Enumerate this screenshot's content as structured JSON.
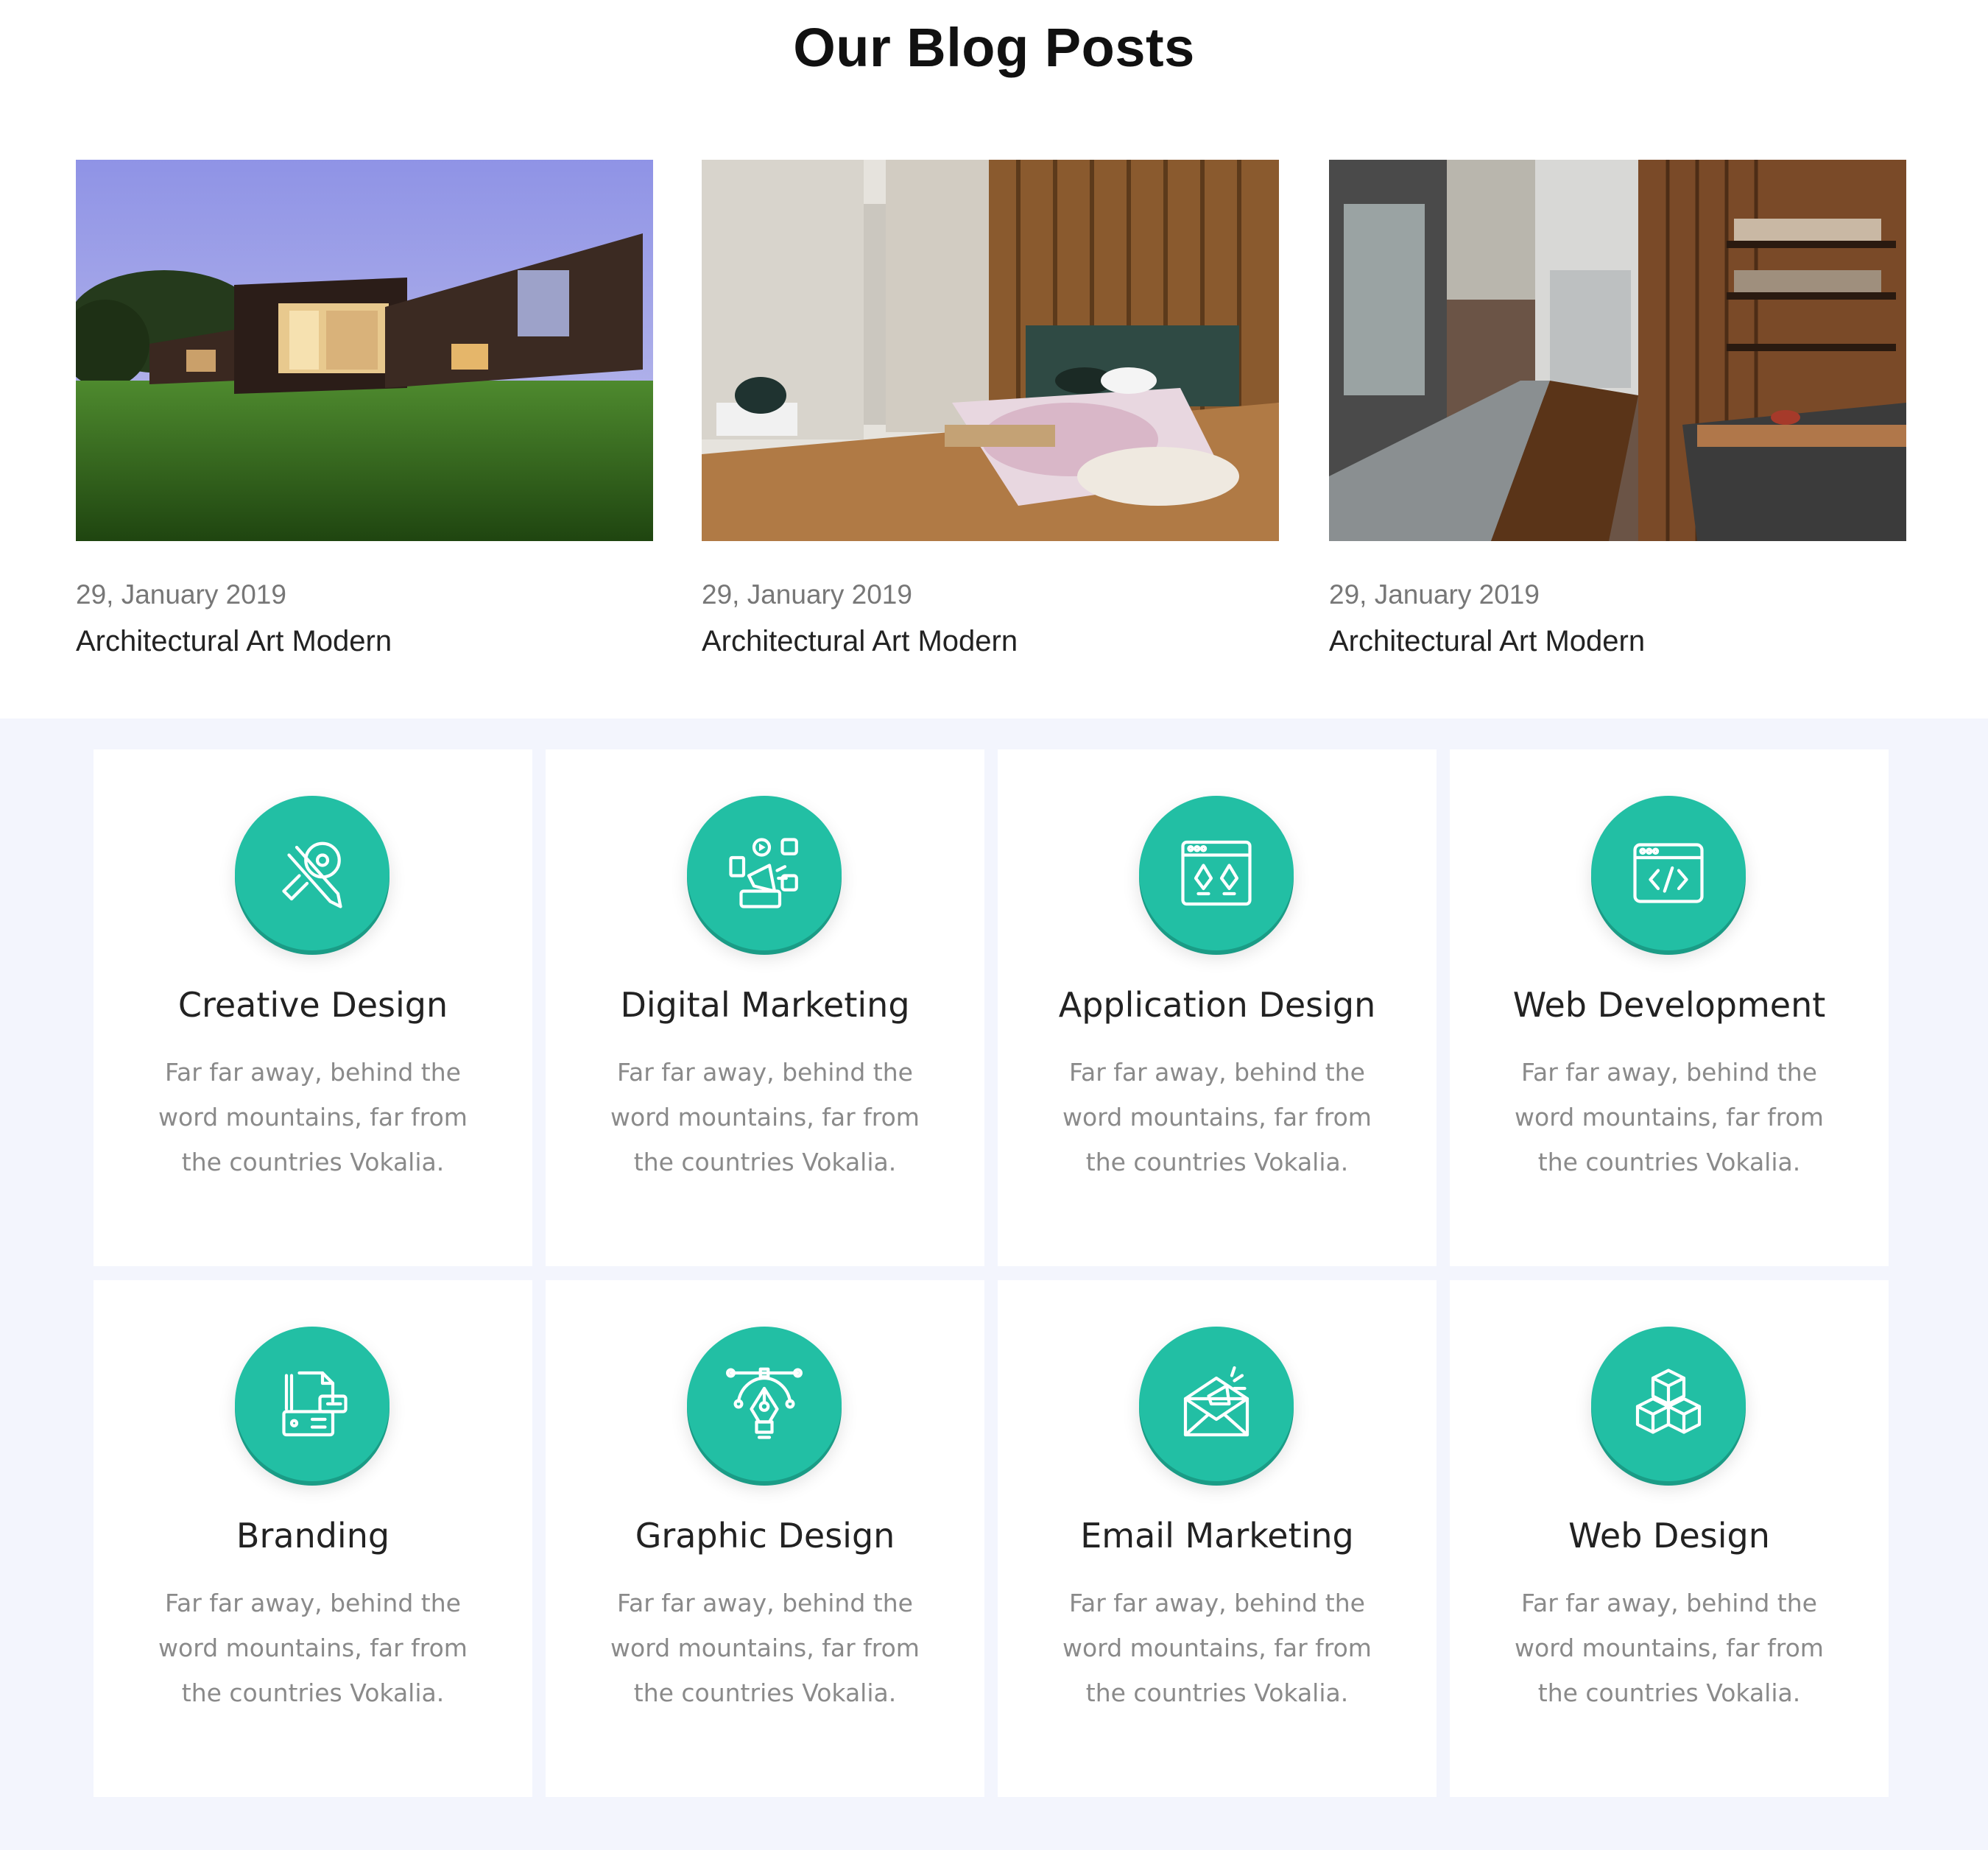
{
  "blog": {
    "title": "Our Blog Posts",
    "posts": [
      {
        "date": "29, January 2019",
        "title": "Architectural Art Modern",
        "image": "modern dark house on green lawn"
      },
      {
        "date": "29, January 2019",
        "title": "Architectural Art Modern",
        "image": "bedroom with wooden wall and floral bedding"
      },
      {
        "date": "29, January 2019",
        "title": "Architectural Art Modern",
        "image": "kitchen with wooden shelves and steel counter"
      }
    ]
  },
  "services": {
    "accent_color": "#22bfa4",
    "items": [
      {
        "title": "Creative Design",
        "icon": "pencil-ruler-icon",
        "desc_lines": [
          "Far far away, behind the",
          "word mountains, far from",
          "the countries Vokalia."
        ]
      },
      {
        "title": "Digital Marketing",
        "icon": "megaphone-social-icon",
        "desc_lines": [
          "Far far away, behind the",
          "word mountains, far from",
          "the countries Vokalia."
        ]
      },
      {
        "title": "Application Design",
        "icon": "browser-pen-tools-icon",
        "desc_lines": [
          "Far far away, behind the",
          "word mountains, far from",
          "the countries Vokalia."
        ]
      },
      {
        "title": "Web Development",
        "icon": "browser-code-icon",
        "desc_lines": [
          "Far far away, behind the",
          "word mountains, far from",
          "the countries Vokalia."
        ]
      },
      {
        "title": "Branding",
        "icon": "stationery-icon",
        "desc_lines": [
          "Far far away, behind the",
          "word mountains, far from",
          "the countries Vokalia."
        ]
      },
      {
        "title": "Graphic Design",
        "icon": "pen-tool-bezier-icon",
        "desc_lines": [
          "Far far away, behind the",
          "word mountains, far from",
          "the countries Vokalia."
        ]
      },
      {
        "title": "Email Marketing",
        "icon": "envelope-megaphone-icon",
        "desc_lines": [
          "Far far away, behind the",
          "word mountains, far from",
          "the countries Vokalia."
        ]
      },
      {
        "title": "Web Design",
        "icon": "cubes-icon",
        "desc_lines": [
          "Far far away, behind the",
          "word mountains, far from",
          "the countries Vokalia."
        ]
      }
    ]
  }
}
